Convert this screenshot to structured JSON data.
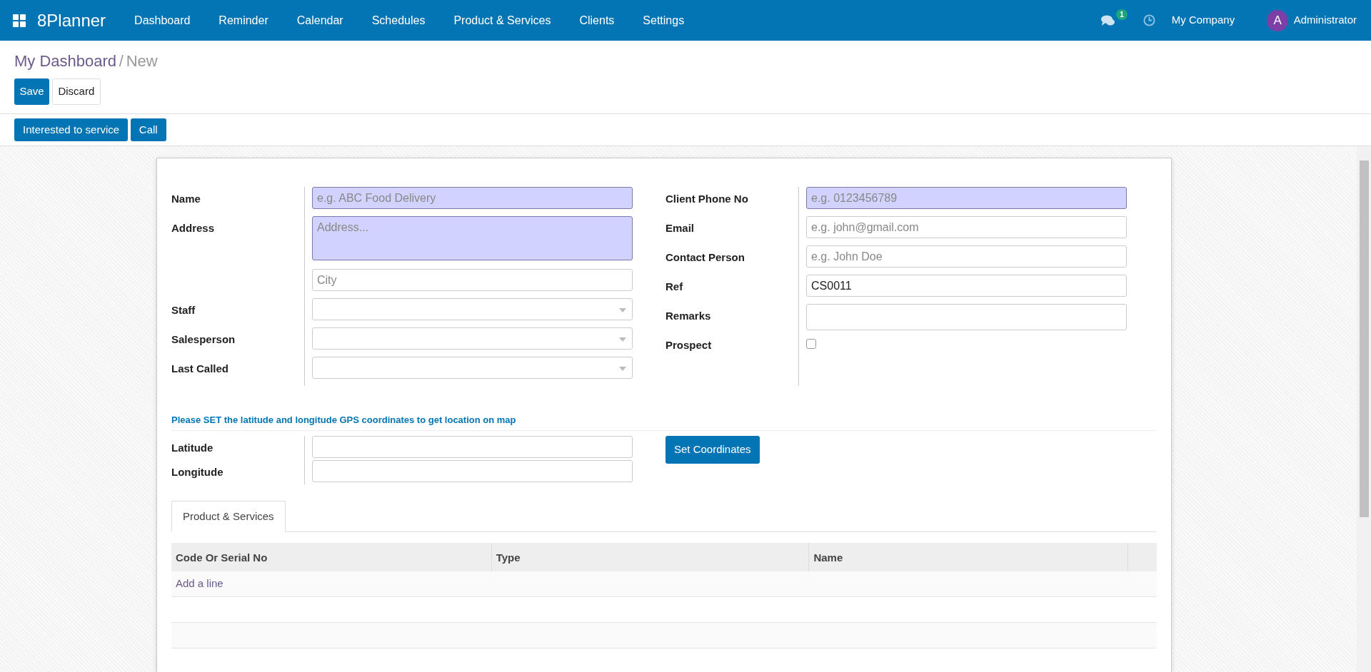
{
  "navbar": {
    "brand": "8Planner",
    "menu": [
      "Dashboard",
      "Reminder",
      "Calendar",
      "Schedules",
      "Product & Services",
      "Clients",
      "Settings"
    ],
    "chat_count": "1",
    "company": "My Company",
    "avatar_letter": "A",
    "user": "Administrator"
  },
  "breadcrumb": {
    "items": [
      "My Dashboard",
      "New"
    ],
    "separator": "/"
  },
  "buttons": [
    "Save",
    "Discard"
  ],
  "actions": [
    "Interested to service",
    "Call"
  ],
  "left_fields": [
    {
      "label": "Name",
      "kind": "text",
      "placeholder": "e.g. ABC Food Delivery",
      "required": true
    },
    {
      "label": "Address",
      "kind": "textarea",
      "placeholder": "Address...",
      "required": true
    },
    {
      "kind": "text",
      "placeholder": "City",
      "required": false
    },
    {
      "label": "Staff",
      "kind": "select",
      "required": false
    },
    {
      "label": "Salesperson",
      "kind": "select",
      "required": false
    },
    {
      "label": "Last Called",
      "kind": "select",
      "required": false
    }
  ],
  "right_fields": [
    {
      "label": "Client Phone No",
      "kind": "text",
      "placeholder": "e.g. 0123456789",
      "required": true
    },
    {
      "label": "Email",
      "kind": "text",
      "placeholder": "e.g. john@gmail.com",
      "required": false
    },
    {
      "label": "Contact Person",
      "kind": "text",
      "placeholder": "e.g. John Doe",
      "required": false
    },
    {
      "label": "Ref",
      "kind": "text",
      "value": "CS0011",
      "required": false
    },
    {
      "label": "Remarks",
      "kind": "tall",
      "required": false
    },
    {
      "label": "Prospect",
      "kind": "checkbox",
      "checked": false
    }
  ],
  "gps": {
    "note": "Please SET the latitude and longitude GPS coordinates to get location on map",
    "fields": [
      {
        "label": "Latitude"
      },
      {
        "label": "Longitude"
      }
    ],
    "button": "Set Coordinates"
  },
  "tabs": [
    {
      "label": "Product & Services",
      "selected": true
    }
  ],
  "table": {
    "columns": [
      "Code Or Serial No",
      "Type",
      "Name"
    ],
    "add_line": "Add a line"
  }
}
